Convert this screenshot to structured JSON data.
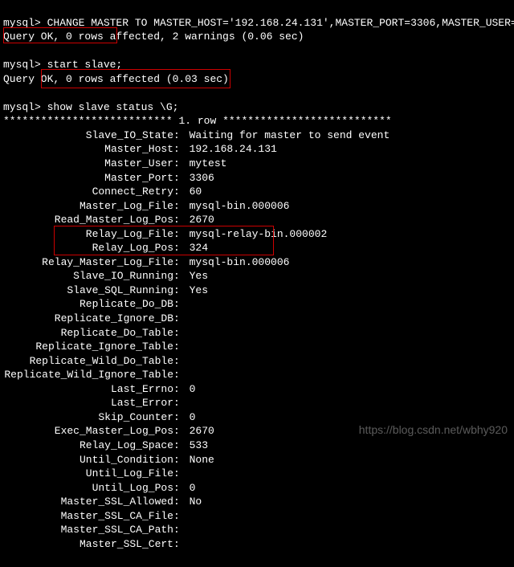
{
  "top_line": "mysql> CHANGE MASTER TO MASTER_HOST='192.168.24.131',MASTER_PORT=3306,MASTER_USER='mytest'",
  "query_ok1": "Query OK, 0 rows affected, 2 warnings (0.06 sec)",
  "prompt": "mysql>",
  "cmd1": " start slave;",
  "query_ok2": "Query OK, 0 rows affected (0.03 sec)",
  "cmd2": " show slave status \\G;",
  "row_divider_left": "***************************",
  "row_divider_label": " 1. row ",
  "row_divider_right": "***************************",
  "status": [
    {
      "k": "Slave_IO_State",
      "v": "Waiting for master to send event"
    },
    {
      "k": "Master_Host",
      "v": "192.168.24.131"
    },
    {
      "k": "Master_User",
      "v": "mytest"
    },
    {
      "k": "Master_Port",
      "v": "3306"
    },
    {
      "k": "Connect_Retry",
      "v": "60"
    },
    {
      "k": "Master_Log_File",
      "v": "mysql-bin.000006"
    },
    {
      "k": "Read_Master_Log_Pos",
      "v": "2670"
    },
    {
      "k": "Relay_Log_File",
      "v": "mysql-relay-bin.000002"
    },
    {
      "k": "Relay_Log_Pos",
      "v": "324"
    },
    {
      "k": "Relay_Master_Log_File",
      "v": "mysql-bin.000006"
    },
    {
      "k": "Slave_IO_Running",
      "v": "Yes"
    },
    {
      "k": "Slave_SQL_Running",
      "v": "Yes"
    },
    {
      "k": "Replicate_Do_DB",
      "v": ""
    },
    {
      "k": "Replicate_Ignore_DB",
      "v": ""
    },
    {
      "k": "Replicate_Do_Table",
      "v": ""
    },
    {
      "k": "Replicate_Ignore_Table",
      "v": ""
    },
    {
      "k": "Replicate_Wild_Do_Table",
      "v": ""
    },
    {
      "k": "Replicate_Wild_Ignore_Table",
      "v": ""
    },
    {
      "k": "Last_Errno",
      "v": "0"
    },
    {
      "k": "Last_Error",
      "v": ""
    },
    {
      "k": "Skip_Counter",
      "v": "0"
    },
    {
      "k": "Exec_Master_Log_Pos",
      "v": "2670"
    },
    {
      "k": "Relay_Log_Space",
      "v": "533"
    },
    {
      "k": "Until_Condition",
      "v": "None"
    },
    {
      "k": "Until_Log_File",
      "v": ""
    },
    {
      "k": "Until_Log_Pos",
      "v": "0"
    },
    {
      "k": "Master_SSL_Allowed",
      "v": "No"
    },
    {
      "k": "Master_SSL_CA_File",
      "v": ""
    },
    {
      "k": "Master_SSL_CA_Path",
      "v": ""
    },
    {
      "k": "Master_SSL_Cert",
      "v": ""
    }
  ],
  "watermark": "https://blog.csdn.net/wbhy920"
}
